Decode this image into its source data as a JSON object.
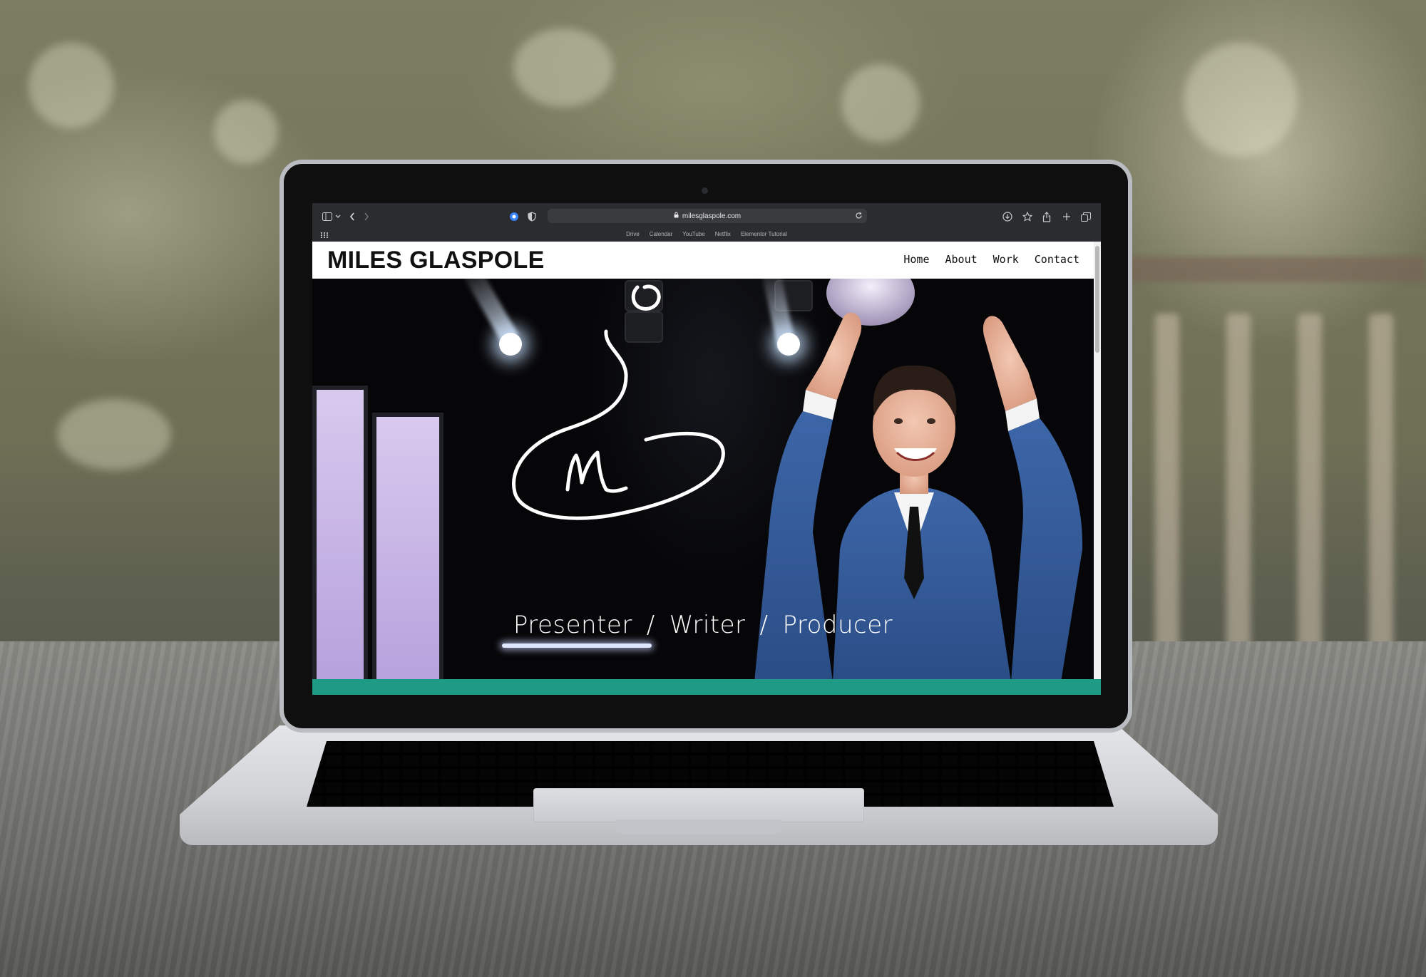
{
  "browser": {
    "url": "milesglaspole.com",
    "bookmarks": [
      "Drive",
      "Calendar",
      "YouTube",
      "Netflix",
      "Elementor Tutorial"
    ]
  },
  "site": {
    "logo": "MILES GLASPOLE",
    "nav": [
      "Home",
      "About",
      "Work",
      "Contact"
    ],
    "tagline": [
      "Presenter",
      "Writer",
      "Producer"
    ],
    "tagline_separator": "/",
    "accent_color": "#1f9a85"
  },
  "icons": [
    "sidebar-icon",
    "chevron-down-icon",
    "back-icon",
    "forward-icon",
    "extension-icon",
    "shield-icon",
    "lock-icon",
    "reload-icon",
    "download-icon",
    "star-icon",
    "share-icon",
    "new-tab-icon",
    "tabs-overview-icon",
    "apps-grid-icon"
  ]
}
